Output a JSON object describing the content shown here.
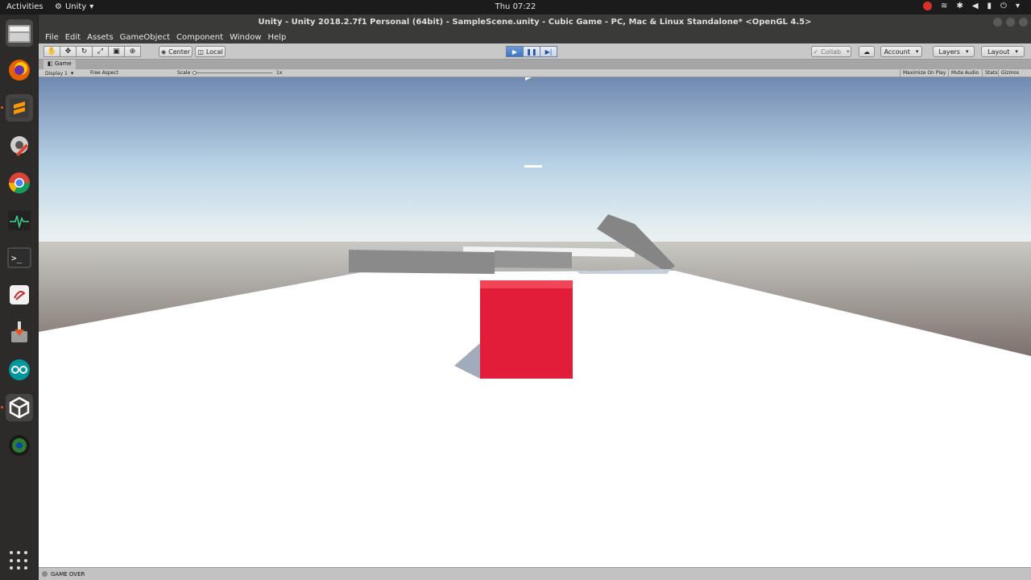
{
  "topbar": {
    "activities": "Activities",
    "app_name": "Unity",
    "clock": "Thu 07:22"
  },
  "dock": {
    "items": [
      "files-icon",
      "firefox-icon",
      "sublime-text-icon",
      "settings-tools-icon",
      "chrome-icon",
      "system-monitor-icon",
      "terminal-icon",
      "gedit-icon",
      "installer-icon",
      "arduino-icon",
      "unity-icon",
      "cheese-icon"
    ]
  },
  "window": {
    "title": "Unity - Unity 2018.2.7f1 Personal (64bit) - SampleScene.unity - Cubic Game - PC, Mac & Linux Standalone* <OpenGL 4.5>"
  },
  "menu": [
    "File",
    "Edit",
    "Assets",
    "GameObject",
    "Component",
    "Window",
    "Help"
  ],
  "toolbar": {
    "pivot": "Center",
    "space": "Local",
    "collab": "Collab",
    "account": "Account",
    "layers": "Layers",
    "layout": "Layout"
  },
  "game_view": {
    "tab_label": "Game",
    "display": "Display 1",
    "aspect": "Free Aspect",
    "scale_label": "Scale",
    "scale_value": "1x",
    "maximize": "Maximize On Play",
    "mute": "Mute Audio",
    "stats": "Stats",
    "gizmos": "Gizmos"
  },
  "status": {
    "message": "GAME OVER"
  },
  "colors": {
    "cube": "#e11d3a",
    "ground": "#ffffff",
    "obstacle": "#8a8a8a",
    "accent": "#e95420"
  }
}
